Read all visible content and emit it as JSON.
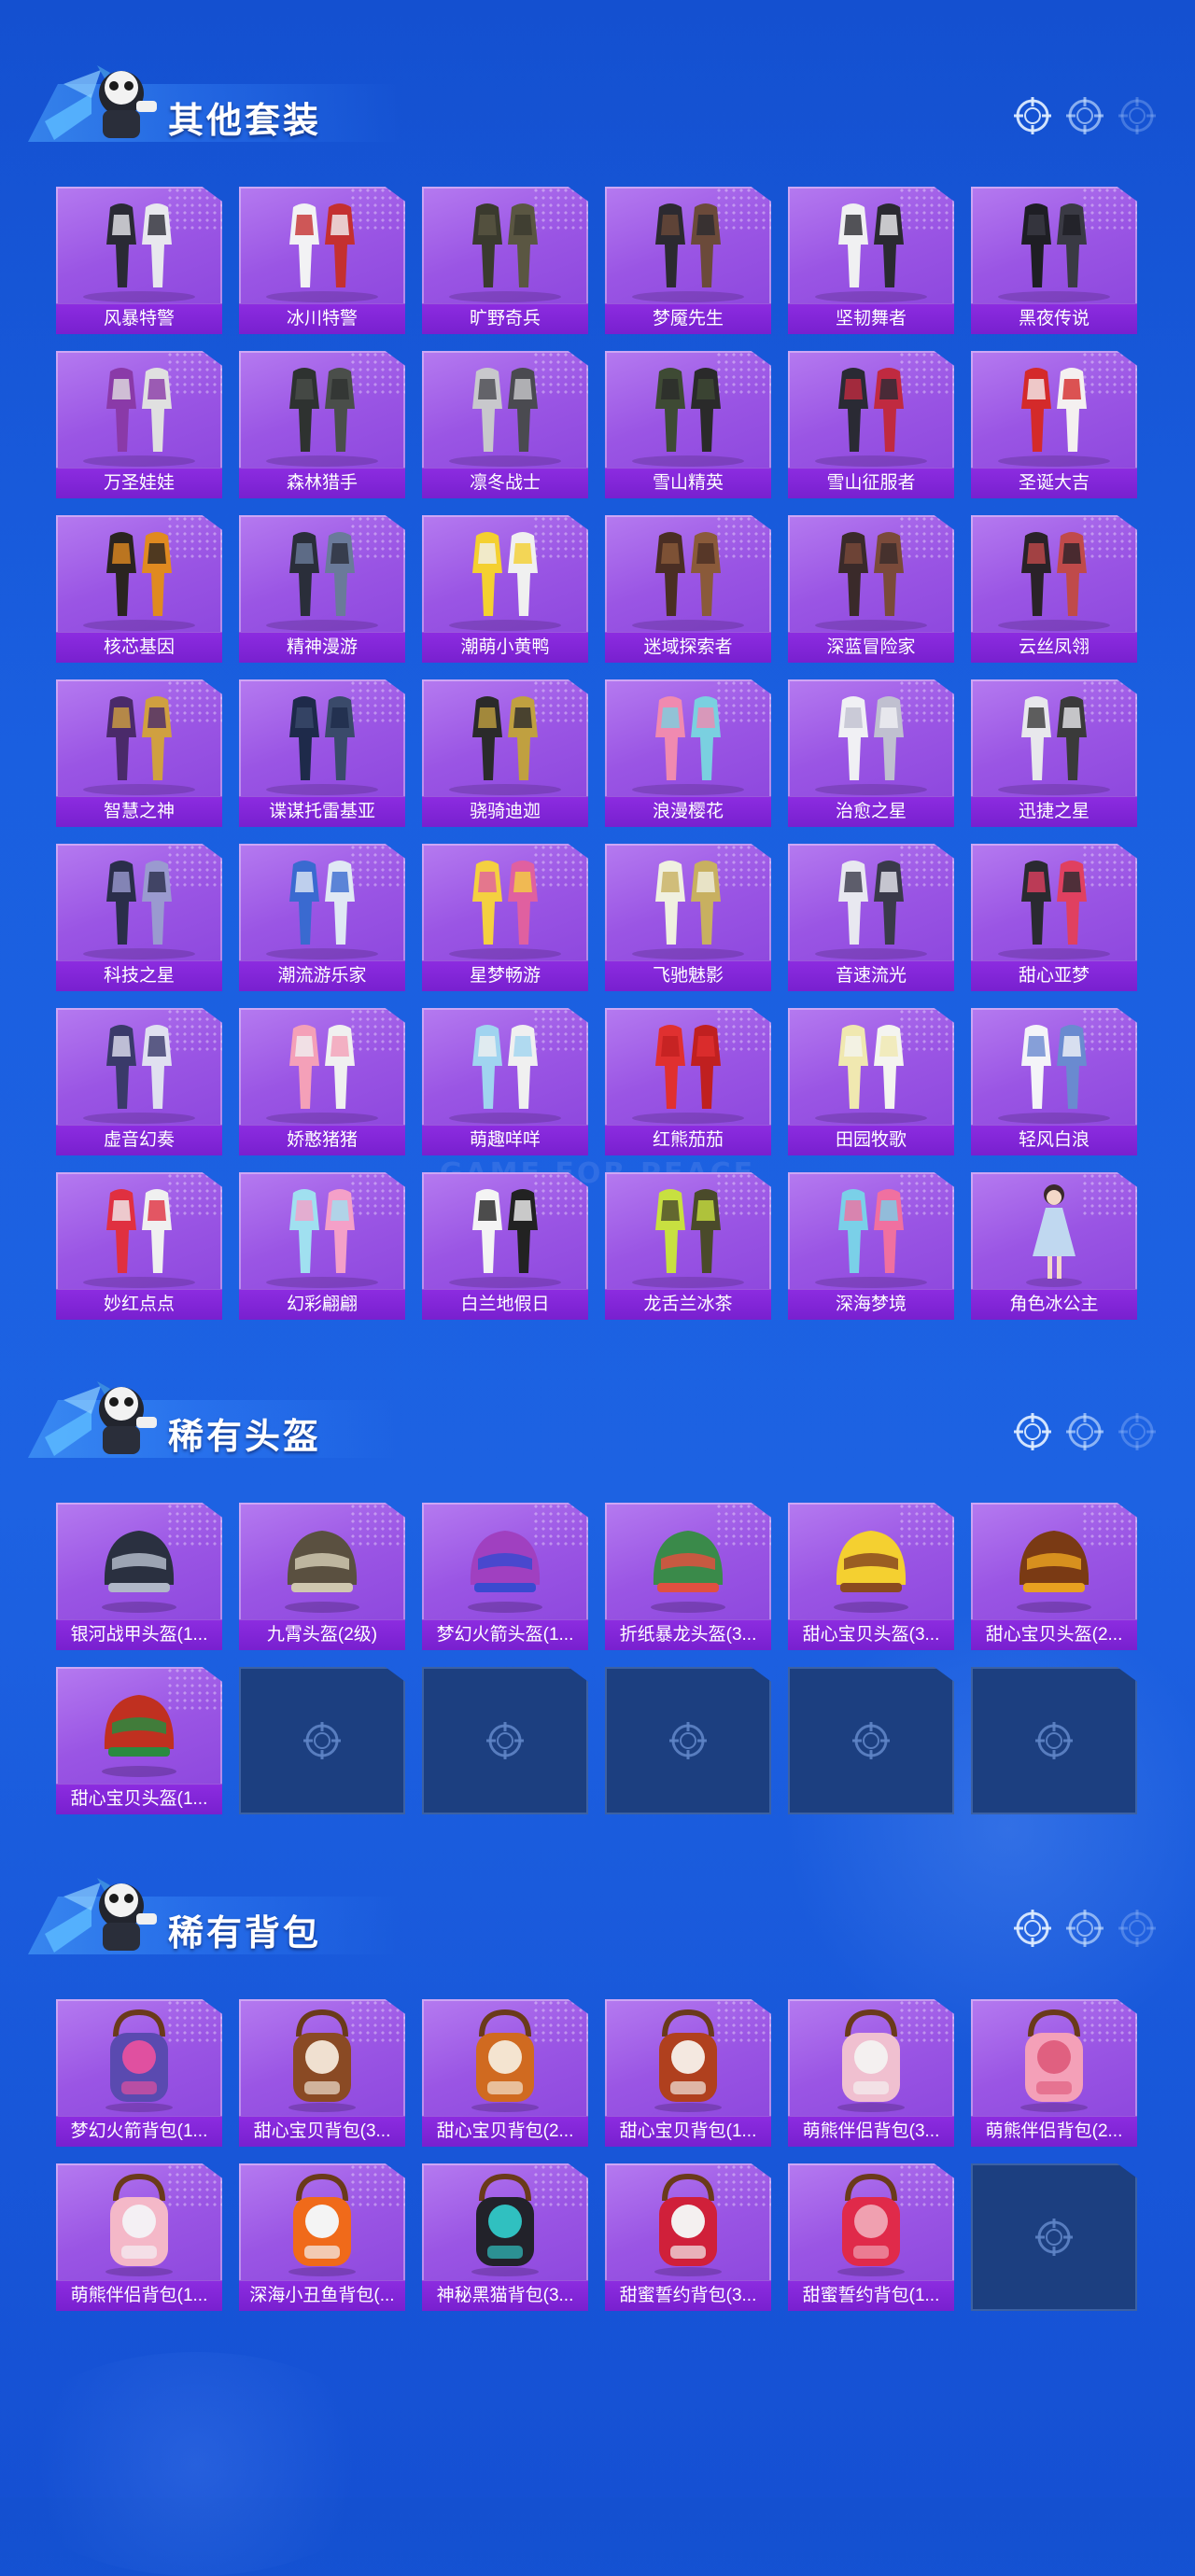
{
  "sections": {
    "outfits": {
      "title": "其他套装",
      "items": [
        {
          "label": "风暴特警",
          "palette": [
            "#2a2a34",
            "#e8e8ee"
          ],
          "kind": "outfit"
        },
        {
          "label": "冰川特警",
          "palette": [
            "#f2f2f4",
            "#c43030"
          ],
          "kind": "outfit"
        },
        {
          "label": "旷野奇兵",
          "palette": [
            "#3a3a2e",
            "#5a5642"
          ],
          "kind": "outfit"
        },
        {
          "label": "梦魇先生",
          "palette": [
            "#2c2a30",
            "#6b4a3a"
          ],
          "kind": "outfit"
        },
        {
          "label": "坚韧舞者",
          "palette": [
            "#f0f0f2",
            "#2a2a30"
          ],
          "kind": "outfit"
        },
        {
          "label": "黑夜传说",
          "palette": [
            "#1e1e24",
            "#3a3a44"
          ],
          "kind": "outfit"
        },
        {
          "label": "万圣娃娃",
          "palette": [
            "#8a3aa8",
            "#e0e0e0"
          ],
          "kind": "outfit"
        },
        {
          "label": "森林猎手",
          "palette": [
            "#2e3230",
            "#4a4e4a"
          ],
          "kind": "outfit"
        },
        {
          "label": "凛冬战士",
          "palette": [
            "#c8c8cc",
            "#4a4a50"
          ],
          "kind": "outfit"
        },
        {
          "label": "雪山精英",
          "palette": [
            "#3e4a34",
            "#2a2a2a"
          ],
          "kind": "outfit"
        },
        {
          "label": "雪山征服者",
          "palette": [
            "#2a2a34",
            "#c02a40"
          ],
          "kind": "outfit"
        },
        {
          "label": "圣诞大吉",
          "palette": [
            "#d42a2a",
            "#f4f0f0"
          ],
          "kind": "outfit"
        },
        {
          "label": "核芯基因",
          "palette": [
            "#2a2420",
            "#e08a20"
          ],
          "kind": "outfit"
        },
        {
          "label": "精神漫游",
          "palette": [
            "#2a2e3a",
            "#6a7a9a"
          ],
          "kind": "outfit"
        },
        {
          "label": "潮萌小黄鸭",
          "palette": [
            "#f4d030",
            "#f0f0f0"
          ],
          "kind": "outfit"
        },
        {
          "label": "迷域探索者",
          "palette": [
            "#4a2e24",
            "#8a5a3a"
          ],
          "kind": "outfit"
        },
        {
          "label": "深蓝冒险家",
          "palette": [
            "#3a2a2a",
            "#7a4a3a"
          ],
          "kind": "outfit"
        },
        {
          "label": "云丝凤翎",
          "palette": [
            "#2a2228",
            "#c04a4a"
          ],
          "kind": "outfit"
        },
        {
          "label": "智慧之神",
          "palette": [
            "#4a2a6a",
            "#d0a040"
          ],
          "kind": "outfit"
        },
        {
          "label": "谍谋托雷基亚",
          "palette": [
            "#1e2a4a",
            "#3a4a6a"
          ],
          "kind": "outfit"
        },
        {
          "label": "骁骑迪迦",
          "palette": [
            "#2a2a2a",
            "#c0a040"
          ],
          "kind": "outfit"
        },
        {
          "label": "浪漫樱花",
          "palette": [
            "#f08ab0",
            "#7ad0e0"
          ],
          "kind": "outfit"
        },
        {
          "label": "治愈之星",
          "palette": [
            "#f0f0f4",
            "#c0c0d0"
          ],
          "kind": "outfit"
        },
        {
          "label": "迅捷之星",
          "palette": [
            "#e8e8ec",
            "#3a3a3a"
          ],
          "kind": "outfit"
        },
        {
          "label": "科技之星",
          "palette": [
            "#2a2e4a",
            "#9a9ad0"
          ],
          "kind": "outfit"
        },
        {
          "label": "潮流游乐家",
          "palette": [
            "#3a6ad0",
            "#e0e8f4"
          ],
          "kind": "outfit"
        },
        {
          "label": "星梦畅游",
          "palette": [
            "#f4d040",
            "#e060a0"
          ],
          "kind": "outfit"
        },
        {
          "label": "飞驰魅影",
          "palette": [
            "#f0f0e0",
            "#c8b060"
          ],
          "kind": "outfit"
        },
        {
          "label": "音速流光",
          "palette": [
            "#e8e8f0",
            "#3a3a4a"
          ],
          "kind": "outfit"
        },
        {
          "label": "甜心亚梦",
          "palette": [
            "#2a2a30",
            "#e04060"
          ],
          "kind": "outfit"
        },
        {
          "label": "虚音幻奏",
          "palette": [
            "#3a3a6a",
            "#e0e0f0"
          ],
          "kind": "outfit"
        },
        {
          "label": "娇憨猪猪",
          "palette": [
            "#f4a0b8",
            "#f0f0f0"
          ],
          "kind": "outfit"
        },
        {
          "label": "萌趣咩咩",
          "palette": [
            "#a0d4f0",
            "#f0f0f0"
          ],
          "kind": "outfit"
        },
        {
          "label": "红熊茄茄",
          "palette": [
            "#e03030",
            "#c02020"
          ],
          "kind": "outfit"
        },
        {
          "label": "田园牧歌",
          "palette": [
            "#f0e8b0",
            "#f4f4f0"
          ],
          "kind": "outfit"
        },
        {
          "label": "轻风白浪",
          "palette": [
            "#f4f4f8",
            "#6a8ad0"
          ],
          "kind": "outfit"
        },
        {
          "label": "妙红点点",
          "palette": [
            "#e03040",
            "#f0f0f0"
          ],
          "kind": "outfit"
        },
        {
          "label": "幻彩翩翩",
          "palette": [
            "#a0e0f0",
            "#f4a0c8"
          ],
          "kind": "outfit"
        },
        {
          "label": "白兰地假日",
          "palette": [
            "#f4f4f4",
            "#222222"
          ],
          "kind": "outfit"
        },
        {
          "label": "龙舌兰冰茶",
          "palette": [
            "#c8e040",
            "#4a4a2a"
          ],
          "kind": "outfit"
        },
        {
          "label": "深海梦境",
          "palette": [
            "#7ad0e8",
            "#f070a0"
          ],
          "kind": "outfit"
        },
        {
          "label": "角色冰公主",
          "palette": [
            "#c0d8f0",
            "#f0f0f8"
          ],
          "kind": "figure"
        }
      ]
    },
    "helmets": {
      "title": "稀有头盔",
      "items": [
        {
          "label": "银河战甲头盔(1...",
          "palette": [
            "#2a3040",
            "#b0b8c8"
          ],
          "kind": "helmet"
        },
        {
          "label": "九霄头盔(2级)",
          "palette": [
            "#5a5040",
            "#d0c8b0"
          ],
          "kind": "helmet"
        },
        {
          "label": "梦幻火箭头盔(1...",
          "palette": [
            "#a040c0",
            "#3a4ad0"
          ],
          "kind": "helmet"
        },
        {
          "label": "折纸暴龙头盔(3...",
          "palette": [
            "#3a8a4a",
            "#e05040"
          ],
          "kind": "helmet"
        },
        {
          "label": "甜心宝贝头盔(3...",
          "palette": [
            "#f4d030",
            "#8a4a20"
          ],
          "kind": "helmet"
        },
        {
          "label": "甜心宝贝头盔(2...",
          "palette": [
            "#7a3a14",
            "#e8a020"
          ],
          "kind": "helmet"
        },
        {
          "label": "甜心宝贝头盔(1...",
          "palette": [
            "#c03020",
            "#2a8a40"
          ],
          "kind": "helmet"
        }
      ],
      "empty_slots": 5
    },
    "backpacks": {
      "title": "稀有背包",
      "items": [
        {
          "label": "梦幻火箭背包(1...",
          "palette": [
            "#5a4ab0",
            "#e050a0"
          ],
          "kind": "bag"
        },
        {
          "label": "甜心宝贝背包(3...",
          "palette": [
            "#8a4a24",
            "#f0e0d0"
          ],
          "kind": "bag"
        },
        {
          "label": "甜心宝贝背包(2...",
          "palette": [
            "#d06a20",
            "#f4e4d0"
          ],
          "kind": "bag"
        },
        {
          "label": "甜心宝贝背包(1...",
          "palette": [
            "#b0401e",
            "#f4e8e0"
          ],
          "kind": "bag"
        },
        {
          "label": "萌熊伴侣背包(3...",
          "palette": [
            "#f0c0d0",
            "#f4f0f0"
          ],
          "kind": "bag"
        },
        {
          "label": "萌熊伴侣背包(2...",
          "palette": [
            "#f4a0b8",
            "#e06080"
          ],
          "kind": "bag"
        },
        {
          "label": "萌熊伴侣背包(1...",
          "palette": [
            "#f4b8c8",
            "#f4f0f4"
          ],
          "kind": "bag"
        },
        {
          "label": "深海小丑鱼背包(...",
          "palette": [
            "#f06a1a",
            "#f4f4f4"
          ],
          "kind": "bag"
        },
        {
          "label": "神秘黑猫背包(3...",
          "palette": [
            "#22222a",
            "#30c0c0"
          ],
          "kind": "bag"
        },
        {
          "label": "甜蜜誓约背包(3...",
          "palette": [
            "#d0203a",
            "#f4f0f0"
          ],
          "kind": "bag"
        },
        {
          "label": "甜蜜誓约背包(1...",
          "palette": [
            "#e02a4a",
            "#f0a0b0"
          ],
          "kind": "bag"
        }
      ],
      "empty_slots": 1
    }
  },
  "watermark": "GAME FOR PEACE",
  "colors": {
    "background": "#1a5fe0",
    "card": "#9a55e4",
    "label_bar": "#7820cf",
    "empty_slot": "#1c3f80"
  },
  "icons": {
    "header_icon": "crosshair-icon",
    "empty_slot_icon": "crosshair-icon",
    "mascot": "mascot-icon"
  }
}
